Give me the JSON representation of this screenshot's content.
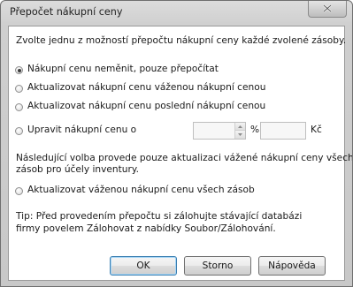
{
  "window": {
    "title": "Přepočet nákupní ceny"
  },
  "intro_text": "Zvolte jednu z možností přepočtu nákupní ceny každé zvolené zásoby.",
  "options": [
    {
      "label": "Nákupní cenu neměnit, pouze přepočítat",
      "selected": true
    },
    {
      "label": "Aktualizovat nákupní cenu váženou nákupní cenou",
      "selected": false
    },
    {
      "label": "Aktualizovat nákupní cenu poslední nákupní cenou",
      "selected": false
    },
    {
      "label": "Upravit nákupní cenu o",
      "selected": false
    }
  ],
  "adjust": {
    "percent_value": "",
    "percent_unit": "%",
    "amount_value": "",
    "currency_unit": "Kč"
  },
  "note_text_line1": "Následující volba provede pouze aktualizaci vážené nákupní ceny všech",
  "note_text_line2": "zásob pro účely inventury.",
  "extra_option": {
    "label": "Aktualizovat váženou nákupní cenu všech zásob",
    "selected": false
  },
  "tip_line1": "Tip: Před provedením přepočtu si zálohujte stávající databázi",
  "tip_line2": "firmy povelem Zálohovat z nabídky Soubor/Zálohování.",
  "buttons": {
    "ok": "OK",
    "cancel": "Storno",
    "help": "Nápověda"
  },
  "colors": {
    "default_button_border": "#3c7fb1",
    "window_frame": "#cfcfcf"
  }
}
